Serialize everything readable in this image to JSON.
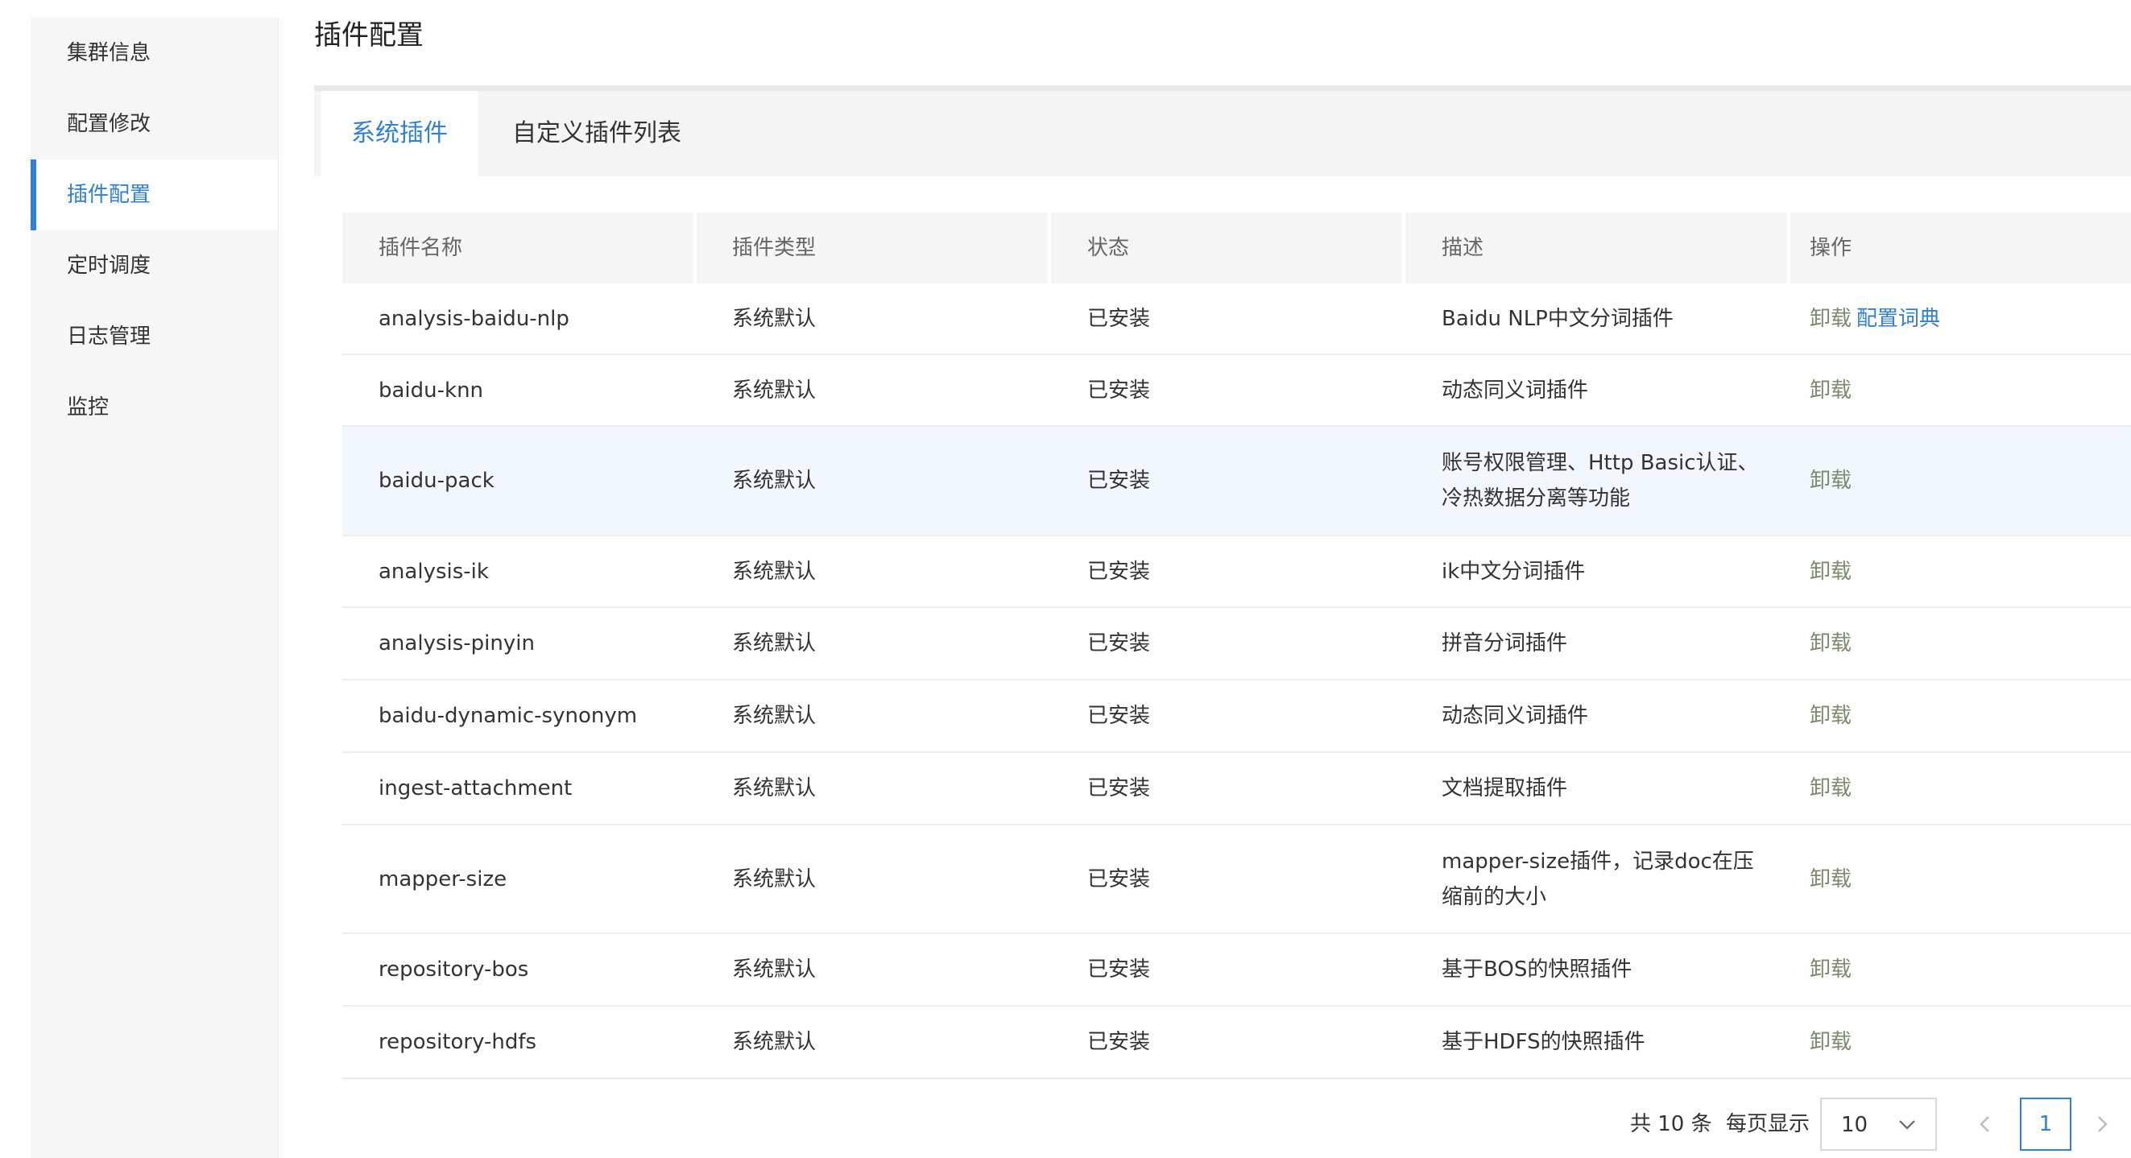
{
  "sidebar": {
    "items": [
      {
        "label": "集群信息"
      },
      {
        "label": "配置修改"
      },
      {
        "label": "插件配置"
      },
      {
        "label": "定时调度"
      },
      {
        "label": "日志管理"
      },
      {
        "label": "监控"
      }
    ],
    "active_index": 2
  },
  "page_title": "插件配置",
  "tabs": [
    {
      "label": "系统插件",
      "active": true
    },
    {
      "label": "自定义插件列表",
      "active": false
    }
  ],
  "table": {
    "headers": [
      "插件名称",
      "插件类型",
      "状态",
      "描述",
      "操作"
    ],
    "rows": [
      {
        "name": "analysis-baidu-nlp",
        "type": "系统默认",
        "status": "已安装",
        "desc": "Baidu NLP中文分词插件",
        "actions": [
          "卸载",
          "配置词典"
        ]
      },
      {
        "name": "baidu-knn",
        "type": "系统默认",
        "status": "已安装",
        "desc": "动态同义词插件",
        "actions": [
          "卸载"
        ]
      },
      {
        "name": "baidu-pack",
        "type": "系统默认",
        "status": "已安装",
        "desc": "账号权限管理、Http Basic认证、冷热数据分离等功能",
        "actions": [
          "卸载"
        ]
      },
      {
        "name": "analysis-ik",
        "type": "系统默认",
        "status": "已安装",
        "desc": "ik中文分词插件",
        "actions": [
          "卸载"
        ]
      },
      {
        "name": "analysis-pinyin",
        "type": "系统默认",
        "status": "已安装",
        "desc": "拼音分词插件",
        "actions": [
          "卸载"
        ]
      },
      {
        "name": "baidu-dynamic-synonym",
        "type": "系统默认",
        "status": "已安装",
        "desc": "动态同义词插件",
        "actions": [
          "卸载"
        ]
      },
      {
        "name": "ingest-attachment",
        "type": "系统默认",
        "status": "已安装",
        "desc": "文档提取插件",
        "actions": [
          "卸载"
        ]
      },
      {
        "name": "mapper-size",
        "type": "系统默认",
        "status": "已安装",
        "desc": "mapper-size插件，记录doc在压缩前的大小",
        "actions": [
          "卸载"
        ]
      },
      {
        "name": "repository-bos",
        "type": "系统默认",
        "status": "已安装",
        "desc": "基于BOS的快照插件",
        "actions": [
          "卸载"
        ]
      },
      {
        "name": "repository-hdfs",
        "type": "系统默认",
        "status": "已安装",
        "desc": "基于HDFS的快照插件",
        "actions": [
          "卸载"
        ]
      }
    ]
  },
  "pagination": {
    "total_text": "共 10 条",
    "page_size_label": "每页显示",
    "page_size": "10",
    "current_page": "1"
  },
  "colors": {
    "accent": "#2f80d8",
    "action_link": "#7a8a6a",
    "row_highlight": "#f1f7fc"
  }
}
